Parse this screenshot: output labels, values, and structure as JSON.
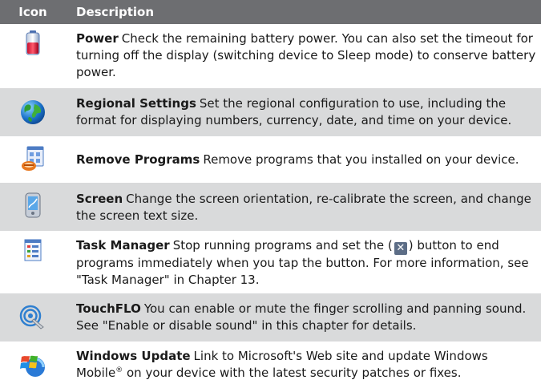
{
  "header": {
    "icon": "Icon",
    "description": "Description"
  },
  "rows": [
    {
      "name": "Power",
      "text": "Check the remaining battery power. You can also set the timeout for turning off the display (switching device to Sleep mode) to conserve battery power.",
      "icon": "battery-icon"
    },
    {
      "name": "Regional Settings",
      "text": "Set the regional configuration to use, including the format for displaying numbers, currency, date, and time on your device.",
      "icon": "globe-icon"
    },
    {
      "name": "Remove Programs",
      "text": "Remove programs that you installed on your device.",
      "icon": "remove-programs-icon"
    },
    {
      "name": "Screen",
      "text": "Change the screen orientation, re-calibrate the screen, and change the screen text size.",
      "icon": "device-screen-icon"
    },
    {
      "name": "Task Manager",
      "text_before": "Stop running programs and set the (",
      "button_glyph": "✕",
      "text_after": ") button to end programs immediately when you tap the button. For more information, see \"Task Manager\" in Chapter 13.",
      "icon": "task-manager-icon"
    },
    {
      "name": "TouchFLO",
      "text": "You can enable or mute the finger scrolling and panning sound. See \"Enable or disable sound\" in this chapter for details.",
      "icon": "touchflo-icon"
    },
    {
      "name": "Windows Update",
      "text_before": "Link to Microsoft's Web site and update Windows Mobile",
      "sup": "®",
      "text_after": " on your device with the latest security patches or fixes.",
      "icon": "windows-update-icon"
    }
  ],
  "colors": {
    "header_bg": "#6d6e71",
    "shaded_row": "#d9dadb",
    "text": "#1a1a1a"
  }
}
